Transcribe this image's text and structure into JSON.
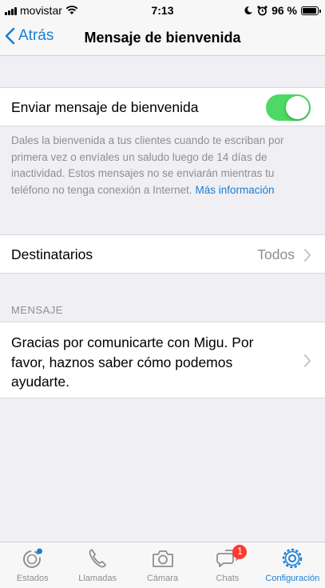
{
  "status_bar": {
    "carrier": "movistar",
    "time": "7:13",
    "battery": "96 %",
    "battery_level": 0.96
  },
  "nav": {
    "back_label": "Atrás",
    "title": "Mensaje de bienvenida"
  },
  "greeting_toggle": {
    "label": "Enviar mensaje de bienvenida",
    "enabled": true
  },
  "footer_note": {
    "text": "Dales la bienvenida a tus clientes cuando te escriban por primera vez o envíales un saludo luego de 14 días de inactividad. Estos mensajes no se enviarán mientras tu teléfono no tenga conexión a Internet.",
    "link": "Más información"
  },
  "recipients": {
    "label": "Destinatarios",
    "value": "Todos"
  },
  "message_section": {
    "header": "MENSAJE",
    "text": "Gracias por comunicarte con Migu. Por favor, haznos saber cómo podemos ayudarte."
  },
  "tabs": [
    {
      "label": "Estados",
      "icon": "status-icon"
    },
    {
      "label": "Llamadas",
      "icon": "phone-icon"
    },
    {
      "label": "Cámara",
      "icon": "camera-icon"
    },
    {
      "label": "Chats",
      "icon": "chats-icon",
      "badge": "1"
    },
    {
      "label": "Configuración",
      "icon": "settings-icon",
      "active": true
    }
  ],
  "colors": {
    "accent": "#1a7fd4",
    "toggle_on": "#4cd964",
    "badge": "#ff3b30"
  }
}
